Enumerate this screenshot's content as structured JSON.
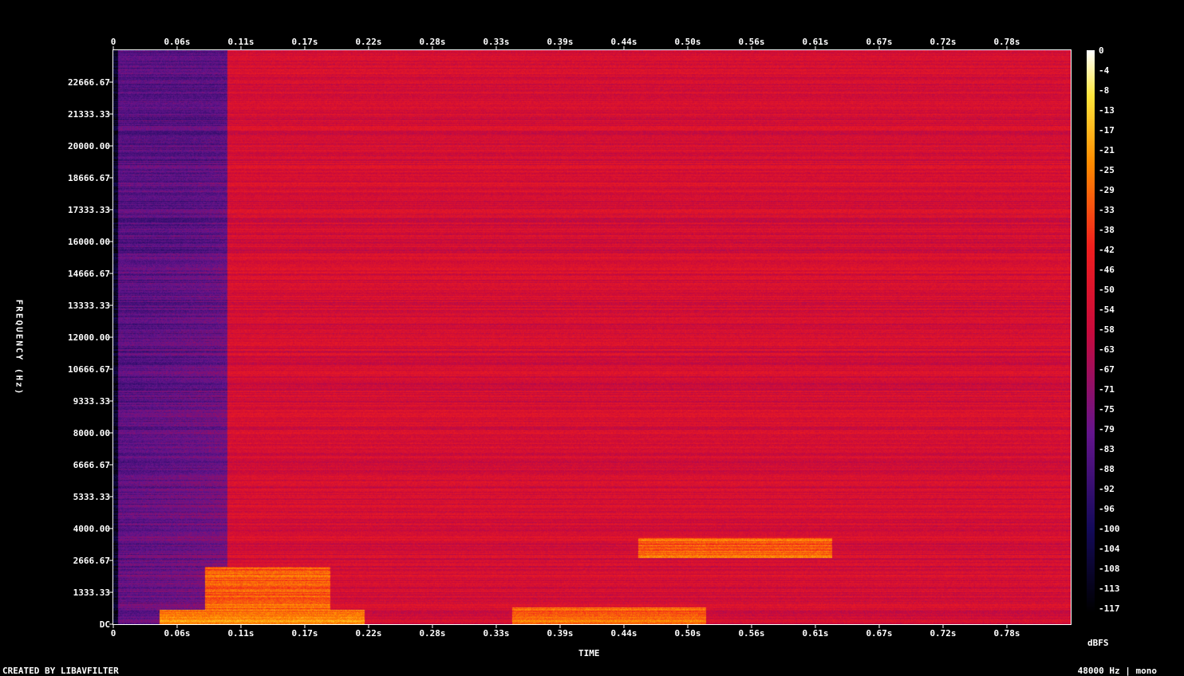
{
  "chart_data": {
    "type": "heatmap",
    "title": "",
    "xlabel": "TIME",
    "ylabel": "FREQUENCY (Hz)",
    "x_ticks_top": [
      "0",
      "0.06s",
      "0.11s",
      "0.17s",
      "0.22s",
      "0.28s",
      "0.33s",
      "0.39s",
      "0.44s",
      "0.50s",
      "0.56s",
      "0.61s",
      "0.67s",
      "0.72s",
      "0.78s"
    ],
    "x_ticks_bottom": [
      "0",
      "0.06s",
      "0.11s",
      "0.17s",
      "0.22s",
      "0.28s",
      "0.33s",
      "0.39s",
      "0.44s",
      "0.50s",
      "0.56s",
      "0.61s",
      "0.67s",
      "0.72s",
      "0.78s"
    ],
    "x_tick_values": [
      0,
      0.056,
      0.112,
      0.168,
      0.224,
      0.28,
      0.336,
      0.392,
      0.448,
      0.504,
      0.56,
      0.616,
      0.672,
      0.728,
      0.784
    ],
    "x_range": [
      0,
      0.84
    ],
    "y_ticks": [
      "DC",
      "1333.33",
      "2666.67",
      "4000.00",
      "5333.33",
      "6666.67",
      "8000.00",
      "9333.33",
      "10666.67",
      "12000.00",
      "13333.33",
      "14666.67",
      "16000.00",
      "17333.33",
      "18666.67",
      "20000.00",
      "21333.33",
      "22666.67"
    ],
    "y_tick_values": [
      0,
      1333.33,
      2666.67,
      4000,
      5333.33,
      6666.67,
      8000,
      9333.33,
      10666.67,
      12000,
      13333.33,
      14666.67,
      16000,
      17333.33,
      18666.67,
      20000,
      21333.33,
      22666.67
    ],
    "y_range": [
      0,
      24000
    ],
    "colorbar": {
      "unit": "dBFS",
      "ticks": [
        "0",
        "-4",
        "-8",
        "-13",
        "-17",
        "-21",
        "-25",
        "-29",
        "-33",
        "-38",
        "-42",
        "-46",
        "-50",
        "-54",
        "-58",
        "-63",
        "-67",
        "-71",
        "-75",
        "-79",
        "-83",
        "-88",
        "-92",
        "-96",
        "-100",
        "-104",
        "-108",
        "-113",
        "-117"
      ],
      "range": [
        -120,
        0
      ]
    },
    "energy_regions": [
      {
        "t": [
          0.04,
          0.22
        ],
        "f": [
          0,
          600
        ],
        "db": -20
      },
      {
        "t": [
          0.08,
          0.19
        ],
        "f": [
          600,
          2400
        ],
        "db": -28
      },
      {
        "t": [
          0.35,
          0.52
        ],
        "f": [
          0,
          700
        ],
        "db": -25
      },
      {
        "t": [
          0.46,
          0.63
        ],
        "f": [
          2800,
          3600
        ],
        "db": -27
      },
      {
        "t": [
          0.1,
          0.84
        ],
        "f": [
          0,
          24000
        ],
        "db": -55
      },
      {
        "t": [
          0.0,
          0.1
        ],
        "f": [
          0,
          24000
        ],
        "db": -85
      }
    ]
  },
  "footer": {
    "left": "CREATED BY LIBAVFILTER",
    "right": "48000 Hz | mono"
  }
}
